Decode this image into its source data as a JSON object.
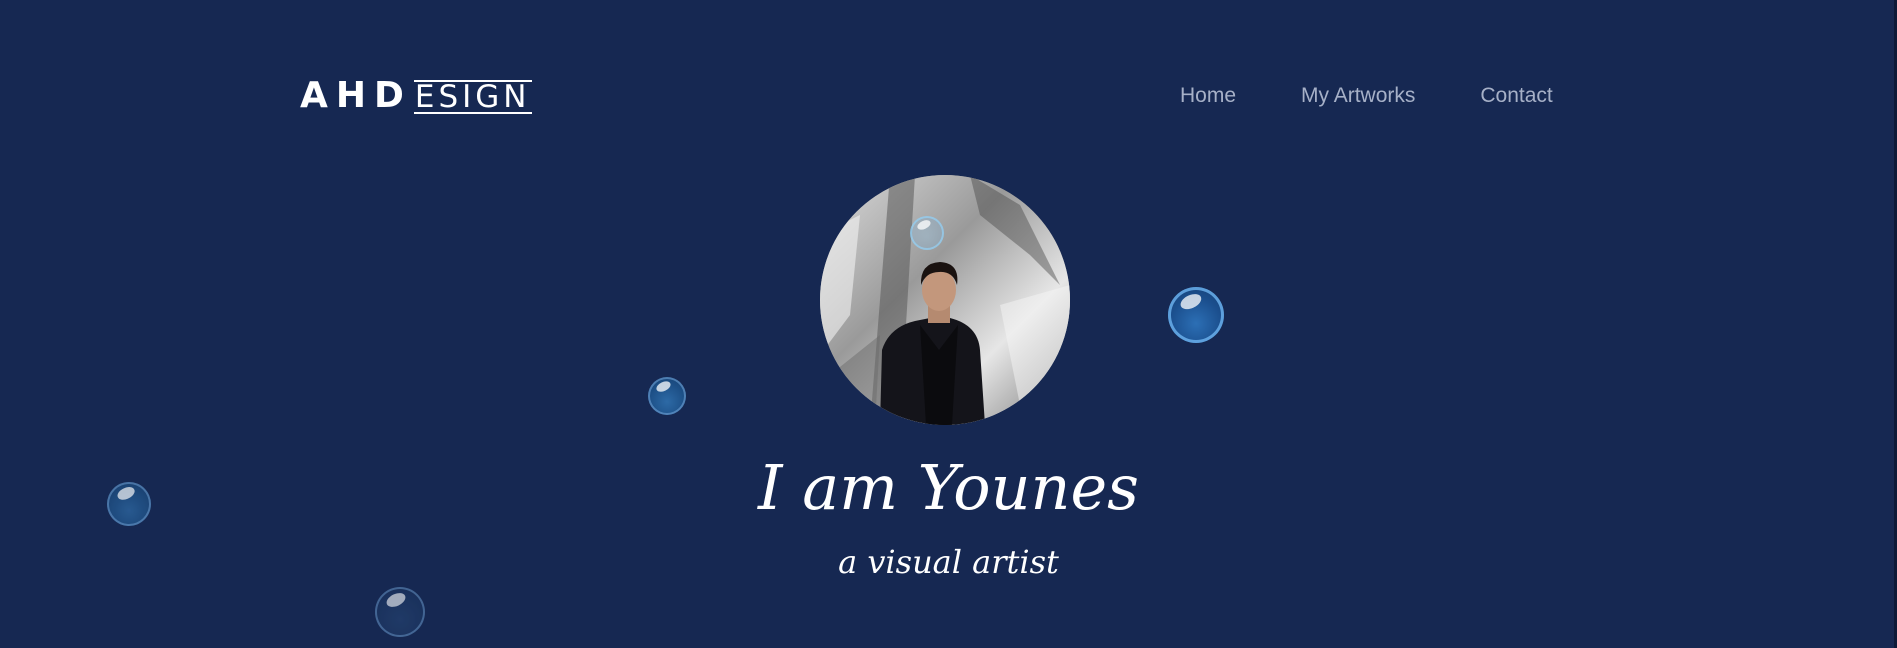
{
  "header": {
    "logo": {
      "initials": "AHD",
      "suffix": "ESIGN"
    },
    "nav": [
      {
        "label": "Home"
      },
      {
        "label": "My Artworks"
      },
      {
        "label": "Contact"
      }
    ]
  },
  "hero": {
    "title": "I am Younes",
    "subtitle": "a visual artist"
  },
  "colors": {
    "background": "#162852",
    "text": "#ffffff",
    "nav_text": "#a6b0c7",
    "bubble": "#1b4f8e"
  }
}
